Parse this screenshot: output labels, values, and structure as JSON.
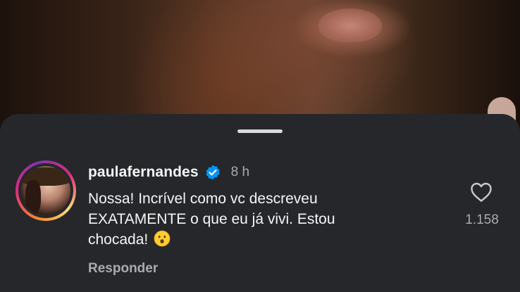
{
  "comment": {
    "username": "paulafernandes",
    "verified": true,
    "time": "8 h",
    "text_line1": "Nossa! Incrível como vc descreveu",
    "text_line2": "EXATAMENTE o que eu já vivi. Estou",
    "text_line3": "chocada!",
    "emoji": "hushed-face-emoji",
    "reply_label": "Responder",
    "like_icon": "heart-icon",
    "like_count": "1.158"
  },
  "colors": {
    "sheet_background": "#25272b",
    "verified_badge": "#0095f6",
    "secondary_text": "#a8abb0",
    "primary_text": "#f5f5f5"
  }
}
